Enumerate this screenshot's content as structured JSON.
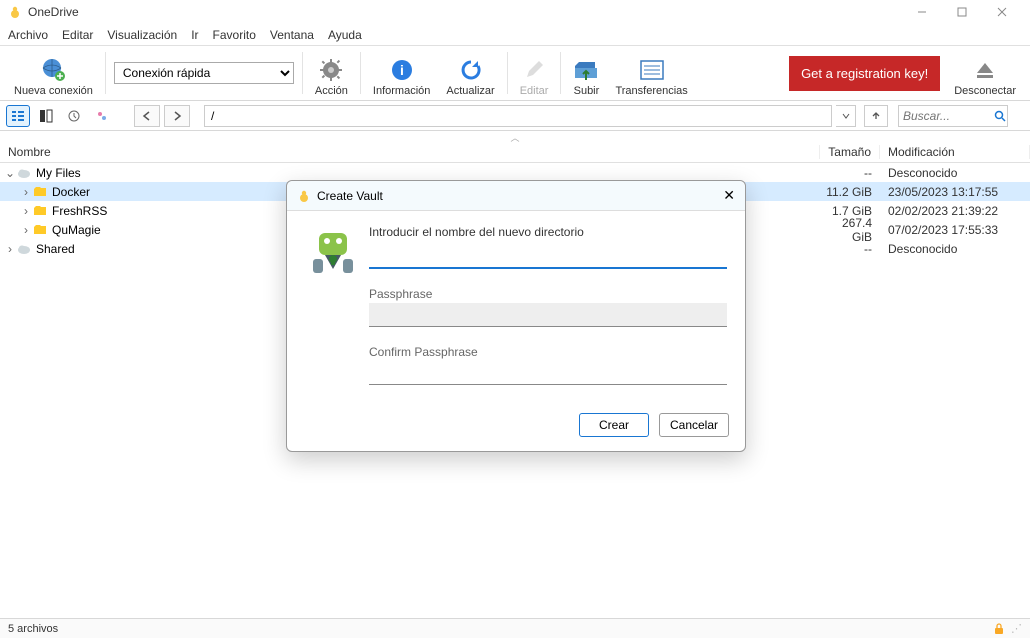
{
  "titlebar": {
    "title": "OneDrive"
  },
  "menu": {
    "items": [
      "Archivo",
      "Editar",
      "Visualización",
      "Ir",
      "Favorito",
      "Ventana",
      "Ayuda"
    ]
  },
  "toolbar": {
    "new_connection": "Nueva conexión",
    "quick_connect": "Conexión rápida",
    "action": "Acción",
    "info": "Información",
    "refresh": "Actualizar",
    "edit": "Editar",
    "upload": "Subir",
    "transfers": "Transferencias",
    "reg_key": "Get a registration key!",
    "disconnect": "Desconectar"
  },
  "path": {
    "value": "/"
  },
  "search": {
    "placeholder": "Buscar..."
  },
  "columns": {
    "name": "Nombre",
    "size": "Tamaño",
    "mod": "Modificación"
  },
  "tree": {
    "myfiles": {
      "label": "My Files",
      "size": "--",
      "mod": "Desconocido"
    },
    "docker": {
      "label": "Docker",
      "size": "11.2 GiB",
      "mod": "23/05/2023 13:17:55"
    },
    "freshrss": {
      "label": "FreshRSS",
      "size": "1.7 GiB",
      "mod": "02/02/2023 21:39:22"
    },
    "qumagie": {
      "label": "QuMagie",
      "size": "267.4 GiB",
      "mod": "07/02/2023 17:55:33"
    },
    "shared": {
      "label": "Shared",
      "size": "--",
      "mod": "Desconocido"
    }
  },
  "dialog": {
    "title": "Create Vault",
    "prompt": "Introducir el nombre del nuevo directorio",
    "name_value": "",
    "pass_label": "Passphrase",
    "confirm_label": "Confirm Passphrase",
    "create": "Crear",
    "cancel": "Cancelar"
  },
  "status": {
    "text": "5 archivos"
  }
}
